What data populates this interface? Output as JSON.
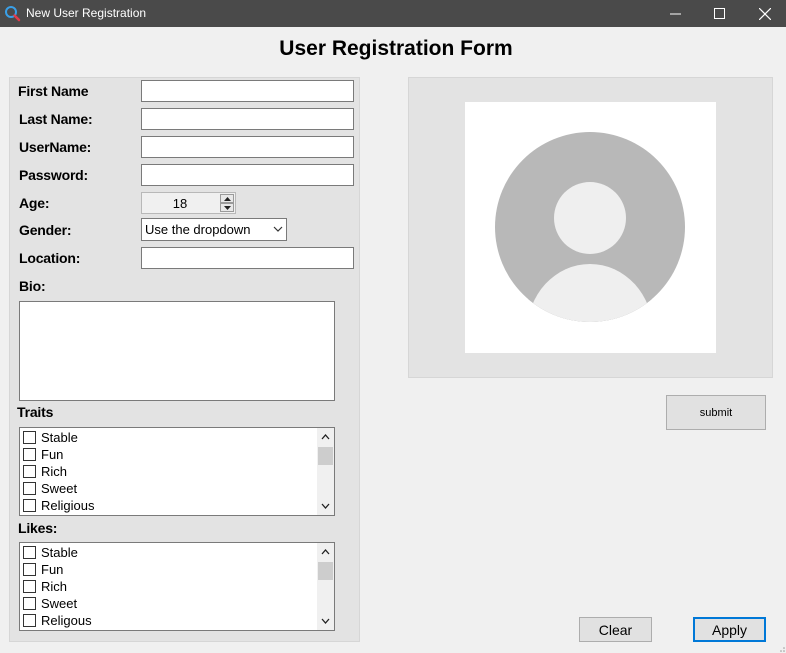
{
  "window": {
    "title": "New User Registration"
  },
  "form": {
    "title": "User Registration Form"
  },
  "fields": {
    "first_name": {
      "label": "First Name",
      "value": ""
    },
    "last_name": {
      "label": "Last Name:",
      "value": ""
    },
    "username": {
      "label": "UserName:",
      "value": ""
    },
    "password": {
      "label": "Password:",
      "value": ""
    },
    "age": {
      "label": "Age:",
      "value": "18"
    },
    "gender": {
      "label": "Gender:",
      "value": "Use the dropdown"
    },
    "location": {
      "label": "Location:",
      "value": ""
    },
    "bio": {
      "label": "Bio:",
      "value": ""
    }
  },
  "traits": {
    "label": "Traits",
    "items": [
      "Stable",
      "Fun",
      "Rich",
      "Sweet",
      "Religious"
    ]
  },
  "likes": {
    "label": "Likes:",
    "items": [
      "Stable",
      "Fun",
      "Rich",
      "Sweet",
      "Religous"
    ]
  },
  "buttons": {
    "submit": "submit",
    "clear": "Clear",
    "apply": "Apply"
  },
  "icons": {
    "app": "search-icon",
    "avatar": "user-avatar-icon"
  },
  "colors": {
    "titlebar": "#4a4a4a",
    "accent": "#0078d7",
    "avatar": "#b8b8b8"
  }
}
